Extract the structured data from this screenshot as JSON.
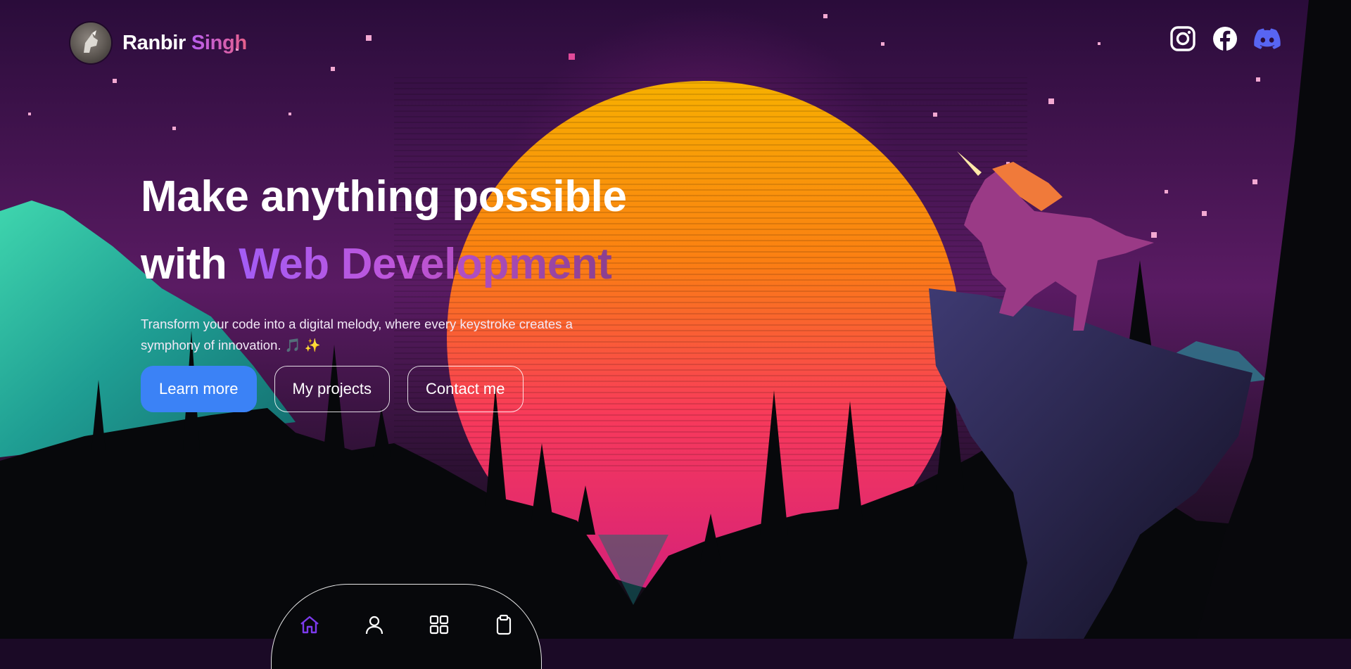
{
  "brand": {
    "first": "Ranbir",
    "last": "Singh",
    "avatar_icon": "unicorn-avatar-icon"
  },
  "social": [
    {
      "name": "instagram-icon",
      "label": "Instagram"
    },
    {
      "name": "facebook-icon",
      "label": "Facebook"
    },
    {
      "name": "discord-icon",
      "label": "Discord"
    }
  ],
  "hero": {
    "line1": "Make anything possible",
    "line2_prefix": "with ",
    "line2_highlight": "Web Development",
    "subtitle": "Transform your code into a digital melody, where every keystroke creates a symphony of innovation. 🎵 ✨"
  },
  "buttons": {
    "learn_more": "Learn more",
    "my_projects": "My projects",
    "contact_me": "Contact me"
  },
  "dock": {
    "items": [
      "home-icon",
      "user-icon",
      "grid-icon",
      "clipboard-icon"
    ],
    "active": "home-icon"
  },
  "colors": {
    "primary_button": "#3b82f6",
    "brand_gradient_start": "#b85ef0",
    "brand_gradient_end": "#e8608a",
    "dock_active": "#7c3aed",
    "discord": "#5865f2"
  }
}
